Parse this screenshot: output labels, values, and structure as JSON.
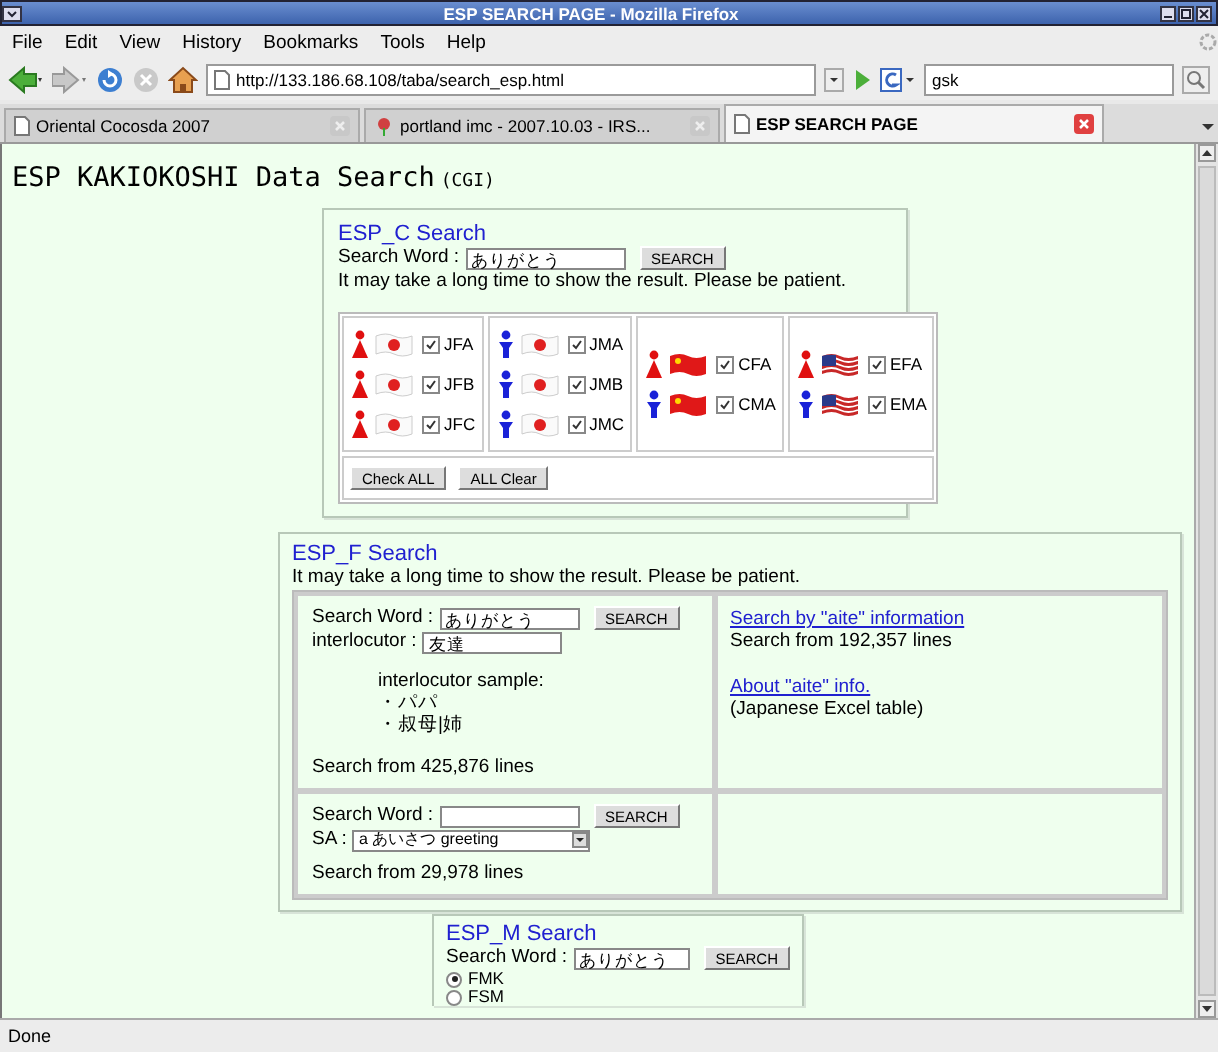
{
  "window": {
    "title": "ESP SEARCH PAGE - Mozilla Firefox"
  },
  "menu": [
    "File",
    "Edit",
    "View",
    "History",
    "Bookmarks",
    "Tools",
    "Help"
  ],
  "address_bar": {
    "value": "http://133.186.68.108/taba/search_esp.html"
  },
  "search_bar": {
    "value": "gsk"
  },
  "tabs": [
    {
      "label": "Oriental Cocosda 2007",
      "selected": false,
      "kind": "page"
    },
    {
      "label": "portland imc - 2007.10.03 - IRS...",
      "selected": false,
      "kind": "flower"
    },
    {
      "label": "ESP SEARCH PAGE",
      "selected": true,
      "kind": "page"
    }
  ],
  "page": {
    "heading": "ESP KAKIOKOSHI Data Search",
    "heading_note": "(CGI)",
    "esp_c": {
      "title": "ESP_C Search",
      "search_label": "Search Word :",
      "search_value": "ありがとう",
      "search_button": "SEARCH",
      "notice": "It may take a long time to show the result. Please be patient.",
      "groups": [
        [
          {
            "label": "JFA",
            "checked": true,
            "kind": "jf"
          },
          {
            "label": "JFB",
            "checked": true,
            "kind": "jf"
          },
          {
            "label": "JFC",
            "checked": true,
            "kind": "jf"
          }
        ],
        [
          {
            "label": "JMA",
            "checked": true,
            "kind": "jm"
          },
          {
            "label": "JMB",
            "checked": true,
            "kind": "jm"
          },
          {
            "label": "JMC",
            "checked": true,
            "kind": "jm"
          }
        ],
        [
          {
            "label": "CFA",
            "checked": true,
            "kind": "cf"
          },
          {
            "label": "CMA",
            "checked": true,
            "kind": "cm"
          }
        ],
        [
          {
            "label": "EFA",
            "checked": true,
            "kind": "ef"
          },
          {
            "label": "EMA",
            "checked": true,
            "kind": "em"
          }
        ]
      ],
      "buttons": [
        "Check ALL",
        "ALL Clear"
      ]
    },
    "esp_f": {
      "title": "ESP_F Search",
      "notice": "It may take a long time to show the result. Please be patient.",
      "search_label": "Search Word :",
      "search_value": "ありがとう",
      "search_button": "SEARCH",
      "interlocutor_label": "interlocutor :",
      "interlocutor_value": "友達",
      "sample_title": "interlocutor sample:",
      "samples": [
        "・パパ",
        "・叔母|姉"
      ],
      "lines": "Search from 425,876 lines",
      "aite_link": "Search by \"aite\" information",
      "aite_lines": "Search from 192,357 lines",
      "about_link": "About \"aite\" info.",
      "about_note": "(Japanese Excel table)",
      "sa_search_label": "Search Word :",
      "sa_search_button": "SEARCH",
      "sa_label": "SA :",
      "sa_value": "a あいさつ greeting",
      "sa_lines": "Search from 29,978 lines"
    },
    "esp_m": {
      "title": "ESP_M Search",
      "search_label": "Search Word :",
      "search_value": "ありがとう",
      "search_button": "SEARCH",
      "options": [
        {
          "label": "FMK",
          "selected": true
        },
        {
          "label": "FSM",
          "selected": false
        }
      ]
    }
  },
  "status_bar": "Done"
}
